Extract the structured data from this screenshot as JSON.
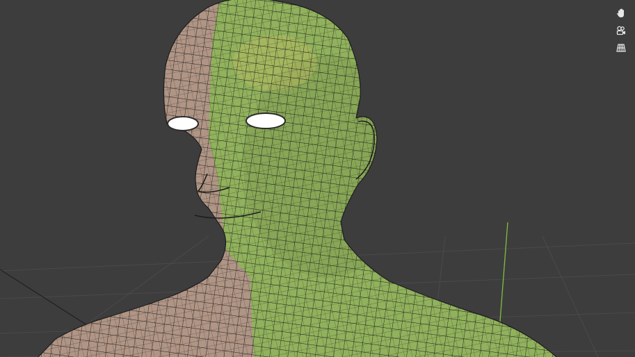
{
  "viewport": {
    "background": "#3d3d3d",
    "grid_color": "#4a4a4a",
    "y_axis_color": "#7fbf3f",
    "x_axis_color": "#2a2a2a"
  },
  "model": {
    "skin_color": "#b09585",
    "highlight_color": "#8fb35a",
    "wire_color": "#1c1c1c",
    "eye_color": "#ffffff"
  },
  "nav_gizmo": {
    "items": [
      {
        "name": "pan-view",
        "icon": "hand-icon"
      },
      {
        "name": "toggle-camera-view",
        "icon": "camera-icon"
      },
      {
        "name": "toggle-perspective",
        "icon": "grid-icon"
      }
    ]
  }
}
